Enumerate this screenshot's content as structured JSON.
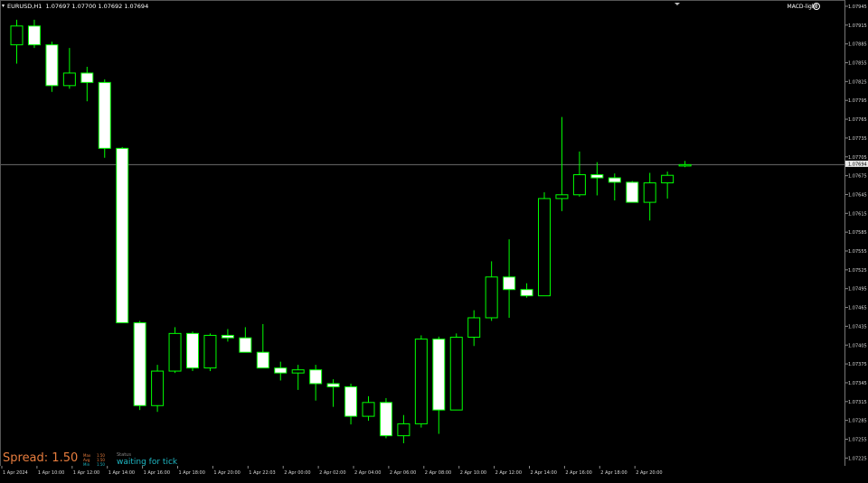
{
  "header": {
    "symbol_text": "EURUSD,H1  1.07697 1.07700 1.07692 1.07694",
    "indicator_label": "MACD-light",
    "indicator_icon": "smiley-icon"
  },
  "colors": {
    "background": "#000000",
    "bull_body": "#000000",
    "bull_outline": "#00ff00",
    "bear_body": "#ffffff",
    "wick": "#00ff00",
    "current_price_line": "#6b6b6b",
    "axis_text": "#d8d8d8",
    "spread_text": "#e87d3e",
    "status_text": "#1fb8c4"
  },
  "spread": {
    "label": "Spread: 1.50",
    "stats_left": [
      "Max",
      "Avg",
      "Min"
    ],
    "stats_right": [
      "1.50",
      "1.50",
      "1.50"
    ]
  },
  "status": {
    "title": "Status",
    "value": "waiting for tick"
  },
  "chart_data": {
    "type": "candlestick",
    "symbol": "EURUSD",
    "timeframe": "H1",
    "current_price": 1.07694,
    "current_price_label": "1.07694",
    "price_range": [
      1.07214,
      1.07955
    ],
    "price_ticks": [
      "1.07945",
      "1.07915",
      "1.07885",
      "1.07855",
      "1.07825",
      "1.07795",
      "1.07765",
      "1.07735",
      "1.07705",
      "1.07675",
      "1.07645",
      "1.07615",
      "1.07585",
      "1.07555",
      "1.07525",
      "1.07495",
      "1.07465",
      "1.07435",
      "1.07405",
      "1.07375",
      "1.07345",
      "1.07315",
      "1.07285",
      "1.07255",
      "1.07225"
    ],
    "price_tick_values": [
      1.07945,
      1.07915,
      1.07885,
      1.07855,
      1.07825,
      1.07795,
      1.07765,
      1.07735,
      1.07705,
      1.07675,
      1.07645,
      1.07615,
      1.07585,
      1.07555,
      1.07525,
      1.07495,
      1.07465,
      1.07435,
      1.07405,
      1.07375,
      1.07345,
      1.07315,
      1.07285,
      1.07255,
      1.07225
    ],
    "time_labels": [
      "1 Apr 2024",
      "1 Apr 10:00",
      "1 Apr 12:00",
      "1 Apr 14:00",
      "1 Apr 16:00",
      "1 Apr 18:00",
      "1 Apr 20:00",
      "1 Apr 22:03",
      "2 Apr 00:00",
      "2 Apr 02:00",
      "2 Apr 04:00",
      "2 Apr 06:00",
      "2 Apr 08:00",
      "2 Apr 10:00",
      "2 Apr 12:00",
      "2 Apr 14:00",
      "2 Apr 16:00",
      "2 Apr 18:00",
      "2 Apr 20:00"
    ],
    "candles": [
      {
        "o": 1.07885,
        "h": 1.07925,
        "l": 1.07855,
        "c": 1.07915
      },
      {
        "o": 1.07915,
        "h": 1.07925,
        "l": 1.0788,
        "c": 1.07885
      },
      {
        "o": 1.07885,
        "h": 1.0789,
        "l": 1.0781,
        "c": 1.0782
      },
      {
        "o": 1.0782,
        "h": 1.0788,
        "l": 1.07815,
        "c": 1.0784
      },
      {
        "o": 1.0784,
        "h": 1.0785,
        "l": 1.07795,
        "c": 1.07825
      },
      {
        "o": 1.07825,
        "h": 1.0783,
        "l": 1.07705,
        "c": 1.0772
      },
      {
        "o": 1.0772,
        "h": 1.07722,
        "l": 1.07442,
        "c": 1.07442
      },
      {
        "o": 1.07442,
        "h": 1.07445,
        "l": 1.07303,
        "c": 1.0731
      },
      {
        "o": 1.0731,
        "h": 1.07375,
        "l": 1.073,
        "c": 1.07365
      },
      {
        "o": 1.07365,
        "h": 1.07435,
        "l": 1.07362,
        "c": 1.07425
      },
      {
        "o": 1.07425,
        "h": 1.07428,
        "l": 1.07365,
        "c": 1.0737
      },
      {
        "o": 1.0737,
        "h": 1.07425,
        "l": 1.07365,
        "c": 1.07422
      },
      {
        "o": 1.07422,
        "h": 1.07432,
        "l": 1.07412,
        "c": 1.07418
      },
      {
        "o": 1.07418,
        "h": 1.07435,
        "l": 1.07395,
        "c": 1.07395
      },
      {
        "o": 1.07395,
        "h": 1.0744,
        "l": 1.07382,
        "c": 1.0737
      },
      {
        "o": 1.0737,
        "h": 1.0738,
        "l": 1.0735,
        "c": 1.07362
      },
      {
        "o": 1.07362,
        "h": 1.07375,
        "l": 1.07335,
        "c": 1.07367
      },
      {
        "o": 1.07367,
        "h": 1.07375,
        "l": 1.07318,
        "c": 1.07345
      },
      {
        "o": 1.07345,
        "h": 1.07352,
        "l": 1.07308,
        "c": 1.0734
      },
      {
        "o": 1.0734,
        "h": 1.07345,
        "l": 1.0728,
        "c": 1.07293
      },
      {
        "o": 1.07293,
        "h": 1.07325,
        "l": 1.07286,
        "c": 1.07315
      },
      {
        "o": 1.07315,
        "h": 1.07322,
        "l": 1.07258,
        "c": 1.07262
      },
      {
        "o": 1.07262,
        "h": 1.07295,
        "l": 1.0725,
        "c": 1.07281
      },
      {
        "o": 1.07281,
        "h": 1.07422,
        "l": 1.07275,
        "c": 1.07416
      },
      {
        "o": 1.07416,
        "h": 1.0742,
        "l": 1.07265,
        "c": 1.07303
      },
      {
        "o": 1.07303,
        "h": 1.07425,
        "l": 1.07303,
        "c": 1.07419
      },
      {
        "o": 1.07419,
        "h": 1.07462,
        "l": 1.07405,
        "c": 1.0745
      },
      {
        "o": 1.0745,
        "h": 1.0754,
        "l": 1.07445,
        "c": 1.07515
      },
      {
        "o": 1.07515,
        "h": 1.07575,
        "l": 1.0745,
        "c": 1.07495
      },
      {
        "o": 1.07495,
        "h": 1.07505,
        "l": 1.07482,
        "c": 1.07485
      },
      {
        "o": 1.07485,
        "h": 1.0765,
        "l": 1.07485,
        "c": 1.0764
      },
      {
        "o": 1.0764,
        "h": 1.0777,
        "l": 1.0762,
        "c": 1.07646
      },
      {
        "o": 1.07646,
        "h": 1.07715,
        "l": 1.07643,
        "c": 1.07678
      },
      {
        "o": 1.07678,
        "h": 1.07698,
        "l": 1.07645,
        "c": 1.07673
      },
      {
        "o": 1.07673,
        "h": 1.0768,
        "l": 1.07637,
        "c": 1.07666
      },
      {
        "o": 1.07666,
        "h": 1.07668,
        "l": 1.07635,
        "c": 1.07634
      },
      {
        "o": 1.07634,
        "h": 1.07681,
        "l": 1.07605,
        "c": 1.07665
      },
      {
        "o": 1.07665,
        "h": 1.07683,
        "l": 1.0764,
        "c": 1.07677
      },
      {
        "o": 1.07694,
        "h": 1.077,
        "l": 1.0769,
        "c": 1.07694
      }
    ]
  }
}
